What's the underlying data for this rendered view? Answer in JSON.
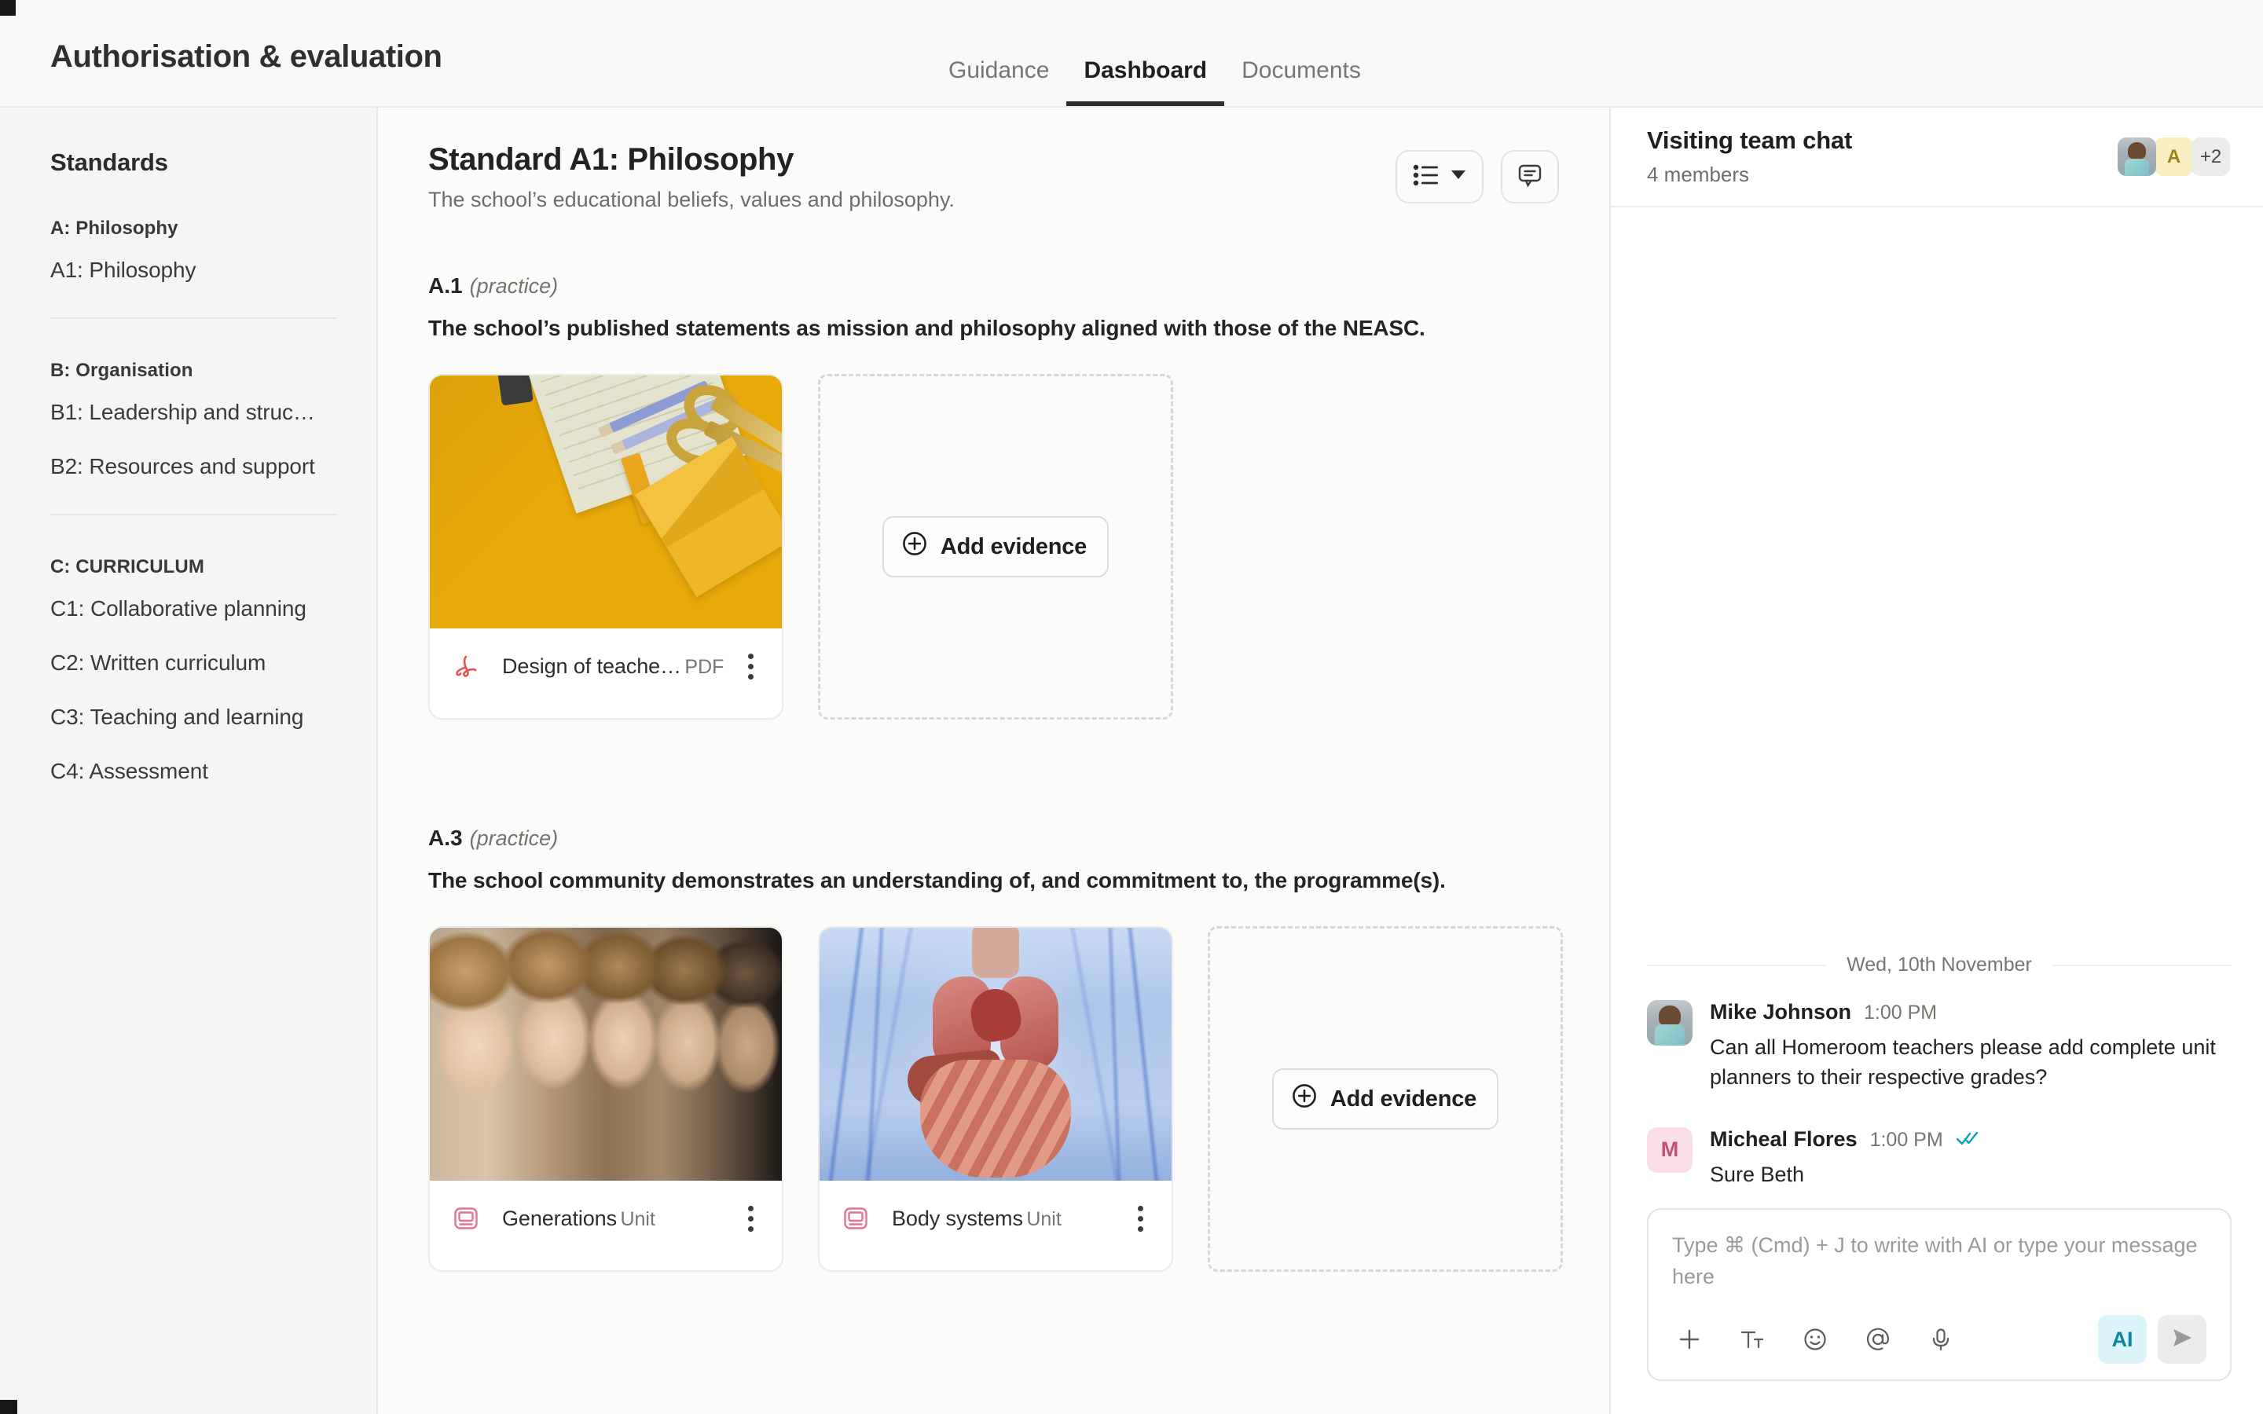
{
  "header": {
    "app_title": "Authorisation & evaluation",
    "tabs": [
      {
        "label": "Guidance",
        "active": false
      },
      {
        "label": "Dashboard",
        "active": true
      },
      {
        "label": "Documents",
        "active": false
      }
    ]
  },
  "sidebar": {
    "title": "Standards",
    "groups": [
      {
        "heading": "A: Philosophy",
        "items": [
          {
            "label": "A1: Philosophy"
          }
        ]
      },
      {
        "heading": "B: Organisation",
        "items": [
          {
            "label": "B1: Leadership and struc…"
          },
          {
            "label": "B2: Resources and support"
          }
        ]
      },
      {
        "heading": "C: CURRICULUM",
        "items": [
          {
            "label": "C1: Collaborative planning"
          },
          {
            "label": "C2: Written curriculum"
          },
          {
            "label": "C3: Teaching and learning"
          },
          {
            "label": "C4: Assessment"
          }
        ]
      }
    ]
  },
  "main": {
    "standard_title": "Standard A1: Philosophy",
    "standard_subtitle": "The school’s educational beliefs, values and philosophy.",
    "toolbar": {
      "view_icon": "list-view-icon",
      "view_chevron": "chevron-down-icon",
      "comment_icon": "comment-icon"
    },
    "sections": [
      {
        "code": "A.1",
        "kind": "(practice)",
        "description": "The school’s published statements as mission and philosophy aligned with those of the NEASC.",
        "cards": [
          {
            "name": "Design of teache…",
            "type": "PDF",
            "icon": "pdf-icon",
            "thumb": "thumb-yellow"
          }
        ],
        "add_label": "Add evidence"
      },
      {
        "code": "A.3",
        "kind": "(practice)",
        "description": "The school community demonstrates an understanding of, and commitment to, the programme(s).",
        "cards": [
          {
            "name": "Generations",
            "type": "Unit",
            "icon": "unit-icon",
            "thumb": "thumb-gen"
          },
          {
            "name": "Body systems",
            "type": "Unit",
            "icon": "unit-icon",
            "thumb": "thumb-body"
          }
        ],
        "add_label": "Add evidence"
      }
    ]
  },
  "chat": {
    "title": "Visiting team chat",
    "members": "4 members",
    "avatars": [
      {
        "kind": "photo",
        "label": ""
      },
      {
        "kind": "letter-a",
        "label": "A"
      },
      {
        "kind": "more",
        "label": "+2"
      }
    ],
    "date_separator": "Wed, 10th November",
    "messages": [
      {
        "author": "Mike Johnson",
        "time": "1:00 PM",
        "text": "Can all Homeroom teachers please add complete unit planners to their respective grades?",
        "avatar_kind": "photo",
        "avatar_label": "",
        "read_receipt": false
      },
      {
        "author": "Micheal Flores",
        "time": "1:00 PM",
        "text": "Sure Beth",
        "avatar_kind": "pink",
        "avatar_label": "M",
        "read_receipt": true
      }
    ],
    "composer": {
      "placeholder": "Type ⌘ (Cmd) + J to write with AI or type your message here",
      "tools": [
        {
          "name": "plus-icon"
        },
        {
          "name": "text-format-icon"
        },
        {
          "name": "emoji-icon"
        },
        {
          "name": "mention-icon"
        },
        {
          "name": "microphone-icon"
        }
      ],
      "ai_label": "AI",
      "send_icon": "send-icon"
    }
  },
  "colors": {
    "accent_teal": "#09889f",
    "pdf_red": "#e8514f",
    "unit_pink": "#e8738f",
    "active_tab": "#2f2f2f"
  }
}
